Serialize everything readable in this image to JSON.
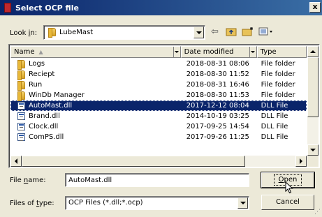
{
  "window": {
    "title": "Select OCP file",
    "close_label": "x"
  },
  "lookin": {
    "label_pre": "Look ",
    "label_u": "i",
    "label_post": "n:",
    "value": "LubeMast"
  },
  "toolbar": {
    "back_icon": "back-arrow-icon",
    "up_icon": "up-folder-icon",
    "newfolder_icon": "new-folder-icon",
    "view_icon": "view-menu-icon"
  },
  "columns": [
    {
      "label": "Name"
    },
    {
      "label": "Date modified"
    },
    {
      "label": "Type"
    }
  ],
  "files": [
    {
      "name": "Logs",
      "date": "2018-08-31 08:06",
      "type": "File folder",
      "kind": "folder"
    },
    {
      "name": "Reciept",
      "date": "2018-08-30 11:52",
      "type": "File folder",
      "kind": "folder"
    },
    {
      "name": "Run",
      "date": "2018-08-31 16:46",
      "type": "File folder",
      "kind": "folder"
    },
    {
      "name": "WinDb Manager",
      "date": "2018-08-30 11:53",
      "type": "File folder",
      "kind": "folder"
    },
    {
      "name": "AutoMast.dll",
      "date": "2017-12-12 08:04",
      "type": "DLL File",
      "kind": "dll",
      "selected": true
    },
    {
      "name": "Brand.dll",
      "date": "2014-10-19 03:25",
      "type": "DLL File",
      "kind": "dll"
    },
    {
      "name": "Clock.dll",
      "date": "2017-09-25 14:54",
      "type": "DLL File",
      "kind": "dll"
    },
    {
      "name": "ComPS.dll",
      "date": "2017-09-26 11:25",
      "type": "DLL File",
      "kind": "dll"
    }
  ],
  "filename": {
    "label_pre": "File ",
    "label_u": "n",
    "label_post": "ame:",
    "value": "AutoMast.dll"
  },
  "filetype": {
    "label_pre": "Files of ",
    "label_u": "t",
    "label_post": "ype:",
    "value": "OCP Files (*.dll;*.ocp)"
  },
  "buttons": {
    "open_u": "O",
    "open_rest": "pen",
    "cancel": "Cancel"
  },
  "colors": {
    "title_start": "#0a246a",
    "title_end": "#3a6ea5",
    "selection": "#0a246a",
    "face": "#ece9d8"
  }
}
